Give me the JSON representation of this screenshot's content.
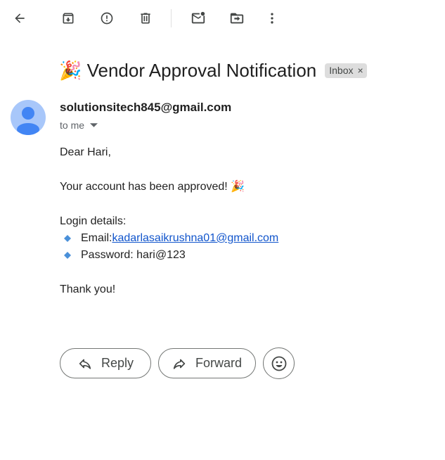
{
  "toolbar": {
    "icons": [
      "back-icon",
      "archive-icon",
      "report-spam-icon",
      "delete-icon",
      "mark-unread-icon",
      "move-to-icon",
      "more-icon"
    ]
  },
  "email": {
    "subject": "🎉 Vendor Approval Notification",
    "label": "Inbox",
    "label_remove": "×",
    "sender": "solutionsitech845@gmail.com",
    "recipient": "to me",
    "greeting": "Dear Hari,",
    "approved_line": "Your account has been approved! 🎉",
    "login_heading": "Login details:",
    "email_label": "Email: ",
    "email_value": "kadarlasaikrushna01@gmail.com",
    "password_line": "Password: hari@123",
    "closing": "Thank you!"
  },
  "actions": {
    "reply_label": "Reply",
    "forward_label": "Forward"
  },
  "colors": {
    "link": "#1155cc",
    "avatar_bg": "#a8c7fa",
    "avatar_fg": "#4285f4",
    "bullet": "#4a90d9",
    "label_chip": "#dddddd"
  }
}
